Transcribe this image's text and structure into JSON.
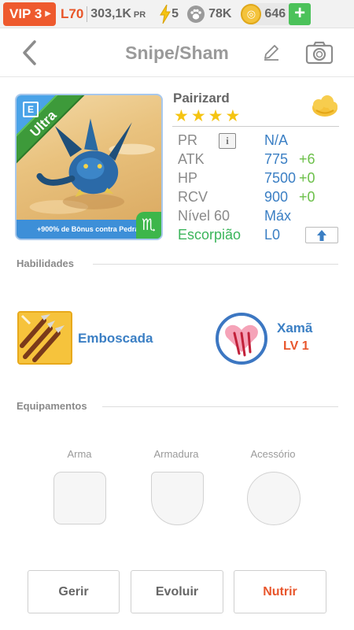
{
  "status": {
    "vip": "VIP 3",
    "level": "L70",
    "power": "303,1K",
    "power_unit": "PR",
    "energy": "5",
    "paws": "78K",
    "coins": "646",
    "add_button": "+"
  },
  "header": {
    "title": "Snipe/Sham"
  },
  "monster": {
    "name": "Pairizard",
    "rarity": "Ultra",
    "stars": 4,
    "bonus_text": "+900% de Bônus contra Pedra",
    "zodiac_symbol": "♏",
    "evolution_mark": "E"
  },
  "stats": {
    "pr_label": "PR",
    "pr_value": "N/A",
    "atk_label": "ATK",
    "atk_value": "775",
    "atk_bonus": "+6",
    "hp_label": "HP",
    "hp_value": "7500",
    "hp_bonus": "+0",
    "rcv_label": "RCV",
    "rcv_value": "900",
    "rcv_bonus": "+0",
    "level_label": "Nível 60",
    "level_value": "Máx",
    "sign_label": "Escorpião",
    "sign_value": "L0"
  },
  "skills": {
    "section_title": "Habilidades",
    "active_name": "Emboscada",
    "leader_name": "Xamã",
    "leader_level": "LV 1"
  },
  "equipment": {
    "section_title": "Equipamentos",
    "weapon_label": "Arma",
    "armor_label": "Armadura",
    "accessory_label": "Acessório"
  },
  "actions": {
    "manage": "Gerir",
    "evolve": "Evoluir",
    "feed": "Nutrir"
  },
  "colors": {
    "accent_orange": "#ee5a2e",
    "stat_blue": "#3b7fc4",
    "bonus_green": "#6cc04a",
    "rarity_green": "#3d9a3a",
    "star_gold": "#f5c412"
  }
}
